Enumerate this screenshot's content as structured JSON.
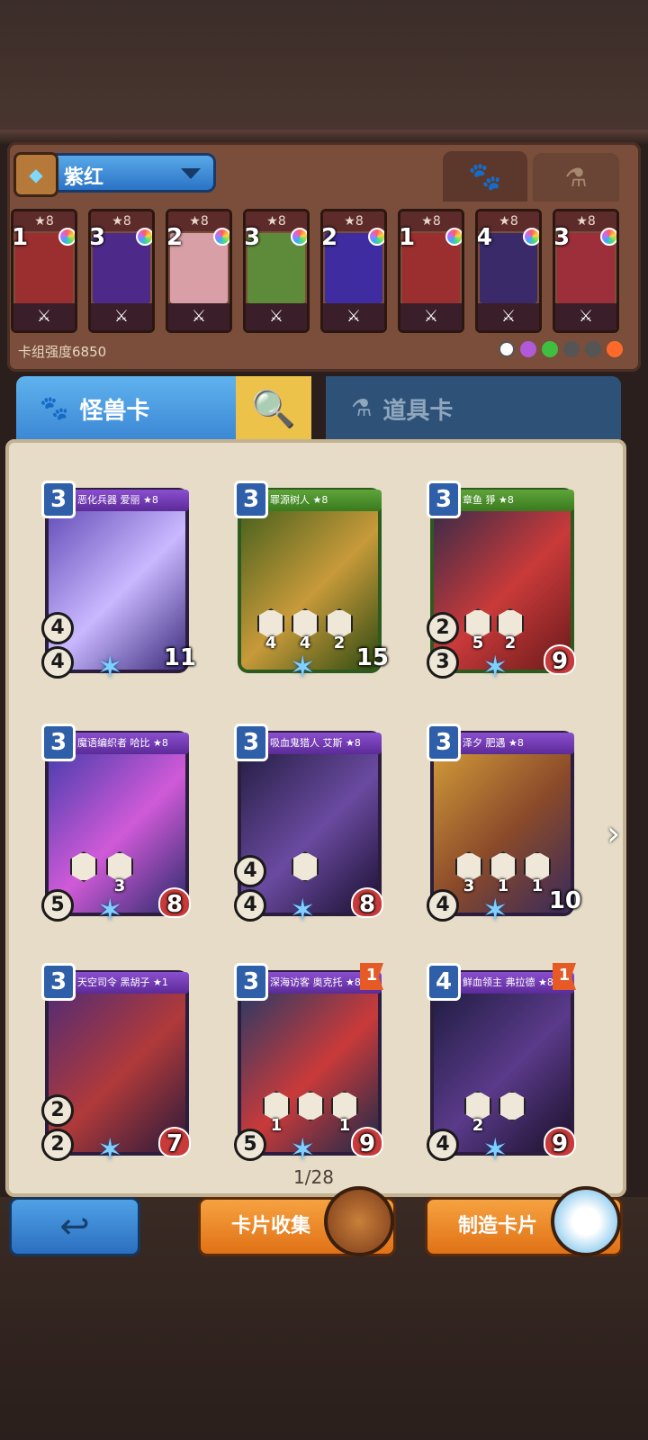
{
  "deck": {
    "name": "紫红",
    "tabs": [
      "paw-icon",
      "potion-icon"
    ],
    "power_label": "卡组强度6850",
    "cards": [
      {
        "count": "1",
        "rank": "★8",
        "art": "#9b2e2e",
        "frame": "#6a2b2b"
      },
      {
        "count": "3",
        "rank": "★8",
        "art": "#4d2a8a",
        "frame": "#5a2f86"
      },
      {
        "count": "2",
        "rank": "★8",
        "art": "#d8a0a6",
        "frame": "#6b3b8b"
      },
      {
        "count": "3",
        "rank": "★8",
        "art": "#5e8b3a",
        "frame": "#6a2b2b"
      },
      {
        "count": "2",
        "rank": "★8",
        "art": "#3f2ca0",
        "frame": "#6b3b8b"
      },
      {
        "count": "1",
        "rank": "★8",
        "art": "#9b2e2e",
        "frame": "#6a2b2b"
      },
      {
        "count": "4",
        "rank": "★8",
        "art": "#3a2a6a",
        "frame": "#6b3b8b"
      },
      {
        "count": "3",
        "rank": "★8",
        "art": "#9c2f3a",
        "frame": "#6a2b2b"
      }
    ],
    "elements": [
      "#ffffff",
      "#b05ad8",
      "#3fbf3f",
      "#555555",
      "#555555",
      "#ff6a2b"
    ]
  },
  "categories": {
    "monster_label": "怪兽卡",
    "item_label": "道具卡"
  },
  "cards": [
    {
      "cost": "3",
      "title": "恶化兵器 爱丽 ★8",
      "atk": "4",
      "def": "4",
      "hp": "11",
      "skills": [],
      "color": "purple",
      "art": "#5a44b0"
    },
    {
      "cost": "3",
      "title": "罪源树人 ★8",
      "atk": "",
      "def": "",
      "hp": "15",
      "skills": [
        "4",
        "4",
        "2"
      ],
      "color": "green",
      "art": "#6b7a2a"
    },
    {
      "cost": "3",
      "title": "章鱼 猙 ★8",
      "atk": "2",
      "def": "3",
      "hp": "9",
      "skills": [
        "5",
        "2"
      ],
      "color": "green",
      "art": "#8a2a2a"
    },
    {
      "cost": "3",
      "title": "魔语编织者 哈比 ★8",
      "atk": "",
      "def": "5",
      "hp": "8",
      "skills": [
        "",
        "3"
      ],
      "color": "purple",
      "art": "#5a3aa8"
    },
    {
      "cost": "3",
      "title": "吸血鬼猎人 艾斯 ★8",
      "atk": "4",
      "def": "4",
      "hp": "8",
      "skills": [
        ""
      ],
      "color": "purple",
      "art": "#3a2a6a"
    },
    {
      "cost": "3",
      "title": "泽夕 肥遇 ★8",
      "atk": "",
      "def": "4",
      "hp": "10",
      "skills": [
        "3",
        "1",
        "1"
      ],
      "color": "purple",
      "art": "#c98a2a"
    },
    {
      "cost": "3",
      "title": "天空司令 黑胡子 ★1",
      "atk": "2",
      "def": "2",
      "hp": "7",
      "skills": [],
      "color": "purple",
      "art": "#6a3aa0"
    },
    {
      "cost": "3",
      "title": "深海访客 奥克托 ★8",
      "atk": "",
      "def": "5",
      "hp": "9",
      "skills": [
        "1",
        "",
        "1"
      ],
      "color": "purple",
      "flag": "1",
      "art": "#2a4a8a"
    },
    {
      "cost": "4",
      "title": "鲜血领主 弗拉德 ★8",
      "atk": "",
      "def": "4",
      "hp": "9",
      "skills": [
        "2",
        ""
      ],
      "color": "purple",
      "flag": "1",
      "art": "#3a2a5a"
    }
  ],
  "pagination": {
    "label": "1/28"
  },
  "buttons": {
    "back": "back-arrow-icon",
    "collect": "卡片收集",
    "craft": "制造卡片"
  }
}
